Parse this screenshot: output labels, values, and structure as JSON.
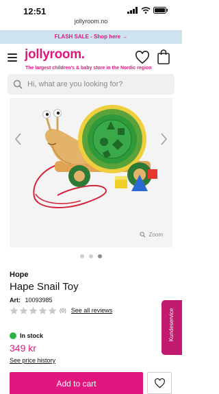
{
  "status": {
    "time": "12:51"
  },
  "browser": {
    "url": "jollyroom.no"
  },
  "banner": {
    "flash_text": "FLASH SALE - Shop here →"
  },
  "header": {
    "logo": "jollyroom.",
    "tagline": "The largest children's & baby store in the Nordic region"
  },
  "search": {
    "placeholder": "Hi, what are you looking for?"
  },
  "gallery": {
    "zoom_label": "Zoom",
    "dots": 3,
    "active_dot": 3
  },
  "product": {
    "brand": "Hope",
    "title": "Hape Snail Toy",
    "art_label": "Art:",
    "art_number": "10093985",
    "rating": 0,
    "review_count": "(0)",
    "see_reviews": "See all reviews",
    "stock_status": "In stock",
    "price": "349 kr",
    "price_history": "See price history",
    "add_to_cart": "Add to cart"
  },
  "widget": {
    "customer_service": "Kundeservice"
  },
  "colors": {
    "brand_pink": "#e0177f",
    "banner_bg": "#cfe3ee",
    "stock_green": "#2db34a",
    "widget_bg": "#c21a6f"
  }
}
